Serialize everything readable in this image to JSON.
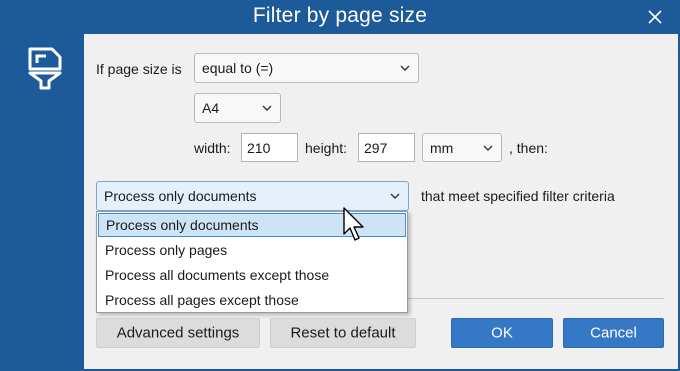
{
  "window": {
    "title": "Filter by page size"
  },
  "icons": {
    "close": "close-icon",
    "logo": "filter-pages-icon",
    "chevron": "chevron-down-icon",
    "cursor": "mouse-pointer-icon"
  },
  "colors": {
    "titlebar": "#1d5a99",
    "primary_button": "#3478c6",
    "selected_option": "#cde4f7"
  },
  "filter": {
    "condition_label": "If page size is",
    "comparison_value": "equal to (=)",
    "paper_size_value": "A4",
    "width_label": "width:",
    "width_value": "210",
    "height_label": "height:",
    "height_value": "297",
    "unit_value": "mm",
    "then_label": ", then:"
  },
  "action": {
    "selected_value": "Process only documents",
    "suffix_label": "that meet specified filter criteria",
    "options": [
      "Process only documents",
      "Process only pages",
      "Process all documents except those",
      "Process all pages except those"
    ]
  },
  "buttons": {
    "advanced": "Advanced settings",
    "reset": "Reset to default",
    "ok": "OK",
    "cancel": "Cancel"
  }
}
